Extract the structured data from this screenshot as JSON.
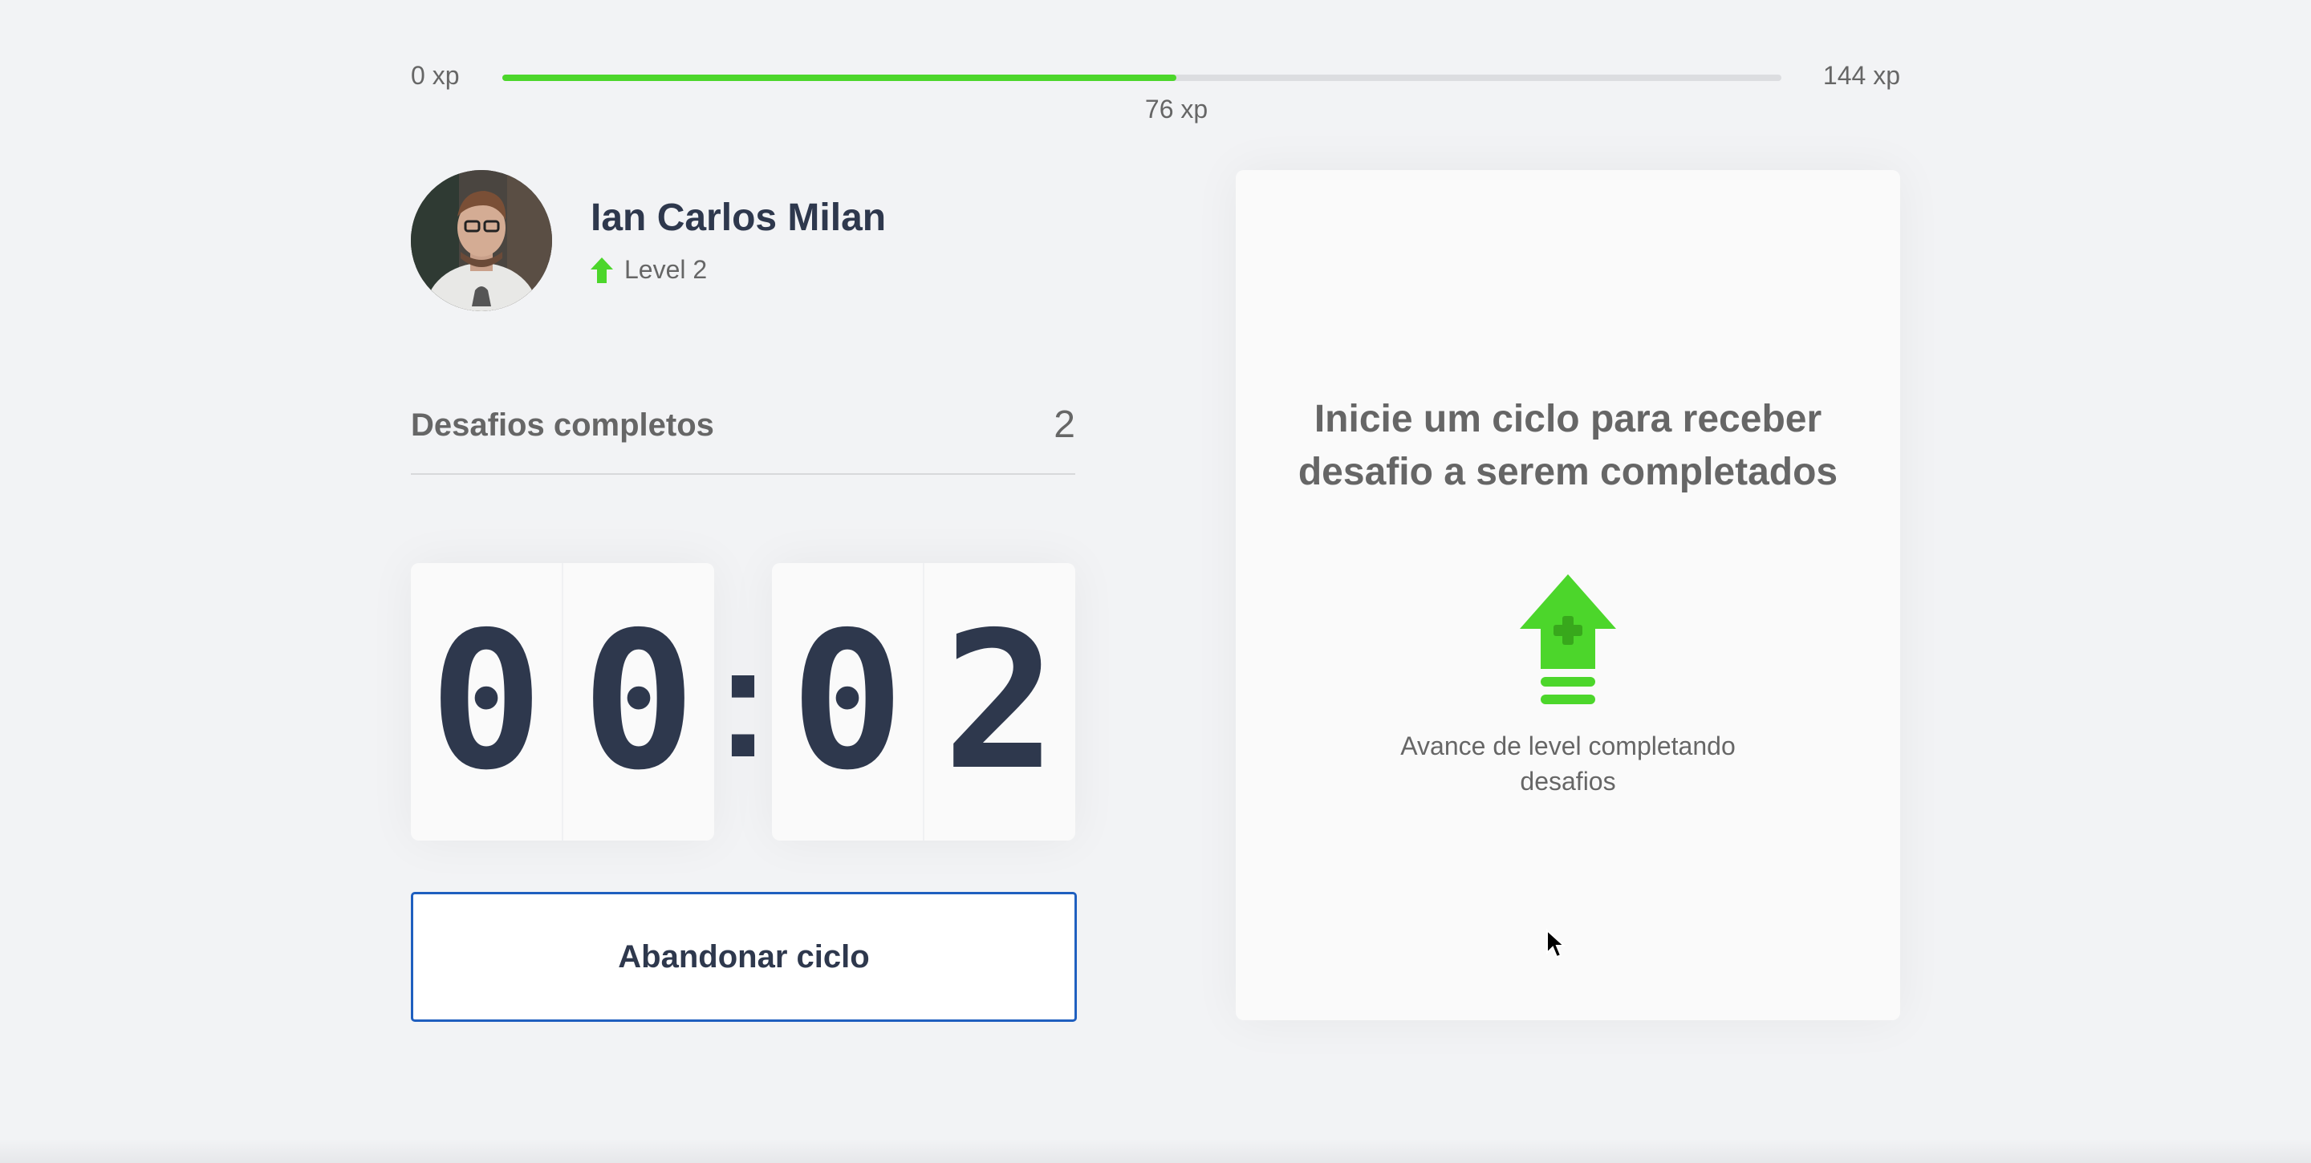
{
  "xp": {
    "min_label": "0 xp",
    "max_label": "144 xp",
    "current_label": "76 xp",
    "progress_fraction": 0.527
  },
  "profile": {
    "name": "Ian Carlos Milan",
    "level_label": "Level 2",
    "avatar_icon": "user-avatar-photo"
  },
  "completed": {
    "label": "Desafios completos",
    "count": "2"
  },
  "countdown": {
    "minutes": [
      "0",
      "0"
    ],
    "separator": ":",
    "seconds": [
      "0",
      "2"
    ]
  },
  "actions": {
    "abandon_label": "Abandonar ciclo"
  },
  "challenge": {
    "title": "Inicie um ciclo para receber desafio a serem completados",
    "icon": "level-up-icon",
    "hint": "Avance de level completando desafios"
  },
  "colors": {
    "accent_green": "#4cd62b",
    "title_dark": "#2e384d",
    "button_border": "#1f5fbf"
  }
}
